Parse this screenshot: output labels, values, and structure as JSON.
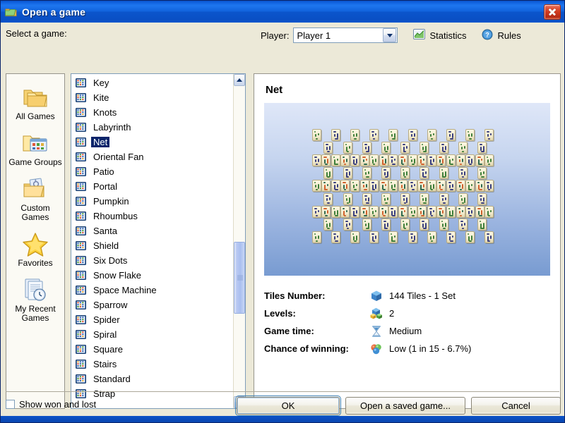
{
  "window": {
    "title": "Open a game",
    "title_icon": "folders-icon",
    "close_label": "Close"
  },
  "header": {
    "select_label": "Select a game:",
    "player_label": "Player:",
    "player_value": "Player 1",
    "player_options": [
      "Player 1"
    ],
    "statistics_label": "Statistics",
    "statistics_icon": "chart-icon",
    "rules_label": "Rules",
    "rules_icon": "help-icon"
  },
  "sidebar": {
    "items": [
      {
        "label": "All Games",
        "icon": "folders-icon"
      },
      {
        "label": "Game Groups",
        "icon": "folder-groups-icon"
      },
      {
        "label": "Custom Games",
        "icon": "folder-custom-icon"
      },
      {
        "label": "Favorites",
        "icon": "star-icon"
      },
      {
        "label": "My Recent Games",
        "icon": "recent-documents-icon"
      }
    ]
  },
  "game_list": {
    "selected": "Net",
    "item_icon": "tile-layout-icon",
    "items": [
      "Key",
      "Kite",
      "Knots",
      "Labyrinth",
      "Net",
      "Oriental Fan",
      "Patio",
      "Portal",
      "Pumpkin",
      "Rhoumbus",
      "Santa",
      "Shield",
      "Six Dots",
      "Snow Flake",
      "Space Machine",
      "Sparrow",
      "Spider",
      "Spiral",
      "Square",
      "Stairs",
      "Standard",
      "Strap"
    ],
    "scrollbar": {
      "up_icon": "chevron-up-icon",
      "down_icon": "chevron-down-icon"
    }
  },
  "detail": {
    "title": "Net",
    "preview_alt": "Net mahjong tile layout preview",
    "stats": [
      {
        "key": "Tiles Number:",
        "value": "144 Tiles - 1 Set",
        "icon": "blue-cube-icon"
      },
      {
        "key": "Levels:",
        "value": "2",
        "icon": "stacked-cubes-icon"
      },
      {
        "key": "Game time:",
        "value": "Medium",
        "icon": "hourglass-icon"
      },
      {
        "key": "Chance of winning:",
        "value": "Low (1 in 15  -  6.7%)",
        "icon": "spheres-icon"
      }
    ]
  },
  "footer": {
    "show_won_lost_label": "Show won and lost",
    "show_won_lost_checked": false,
    "ok_label": "OK",
    "open_saved_label": "Open a saved game...",
    "cancel_label": "Cancel"
  },
  "colors": {
    "titlebar_blue": "#0b52c8",
    "selection_blue": "#0a246a",
    "dialog_face": "#ece9d8",
    "panel_cream": "#fbfaf4",
    "close_red": "#d03a20"
  }
}
